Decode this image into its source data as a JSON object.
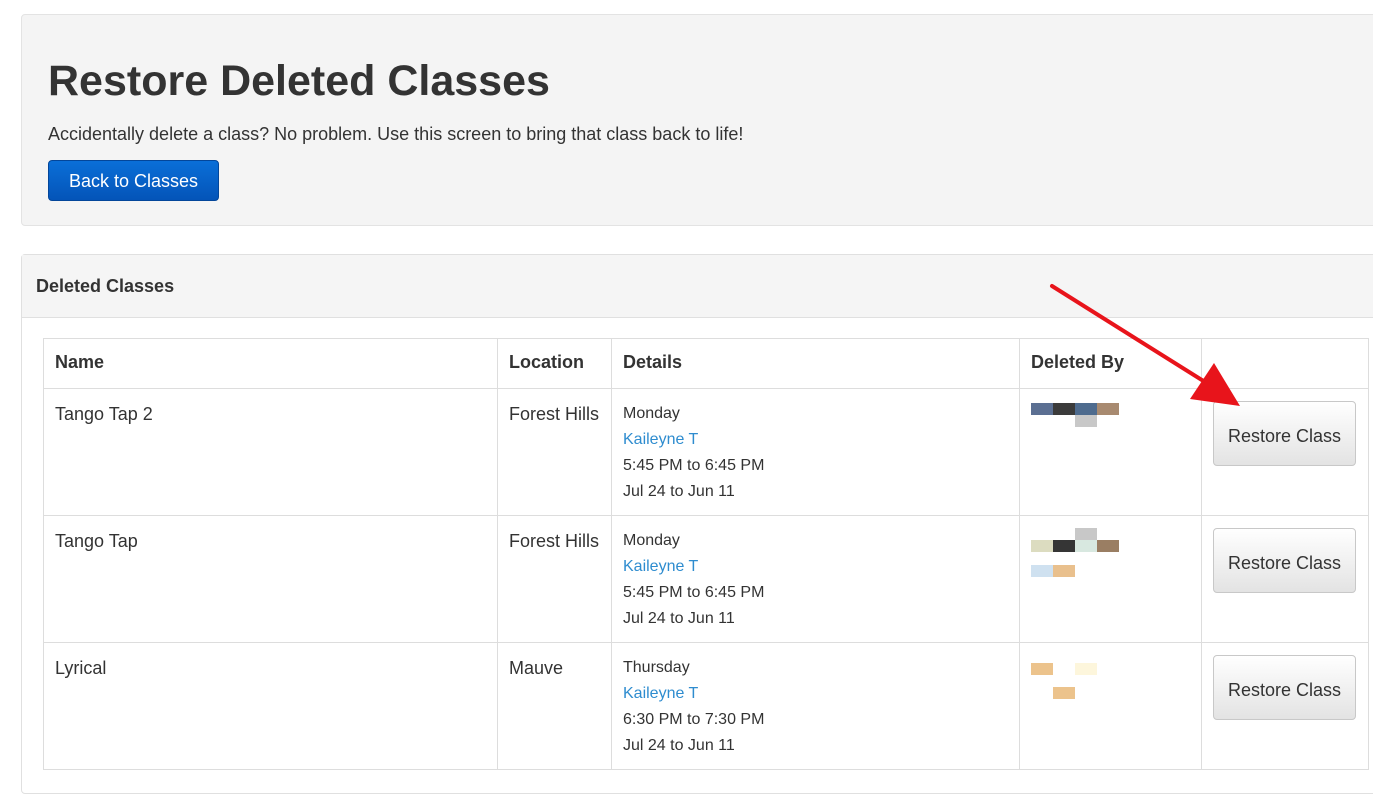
{
  "header": {
    "title": "Restore Deleted Classes",
    "subtitle": "Accidentally delete a class? No problem. Use this screen to bring that class back to life!",
    "back_button": "Back to Classes"
  },
  "panel": {
    "title": "Deleted Classes",
    "columns": [
      "Name",
      "Location",
      "Details",
      "Deleted By",
      ""
    ],
    "rows": [
      {
        "name": "Tango Tap 2",
        "location": "Forest Hills",
        "day": "Monday",
        "instructor": "Kaileyne T",
        "time": "5:45 PM to 6:45 PM",
        "dates": "Jul 24 to Jun 11",
        "action": "Restore Class"
      },
      {
        "name": "Tango Tap",
        "location": "Forest Hills",
        "day": "Monday",
        "instructor": "Kaileyne T",
        "time": "5:45 PM to 6:45 PM",
        "dates": "Jul 24 to Jun 11",
        "action": "Restore Class"
      },
      {
        "name": "Lyrical",
        "location": "Mauve",
        "day": "Thursday",
        "instructor": "Kaileyne T",
        "time": "6:30 PM to 7:30 PM",
        "dates": "Jul 24 to Jun 11",
        "action": "Restore Class"
      }
    ]
  },
  "colors": {
    "primary_button": "#0a63c9",
    "link": "#2e8ccf",
    "annotation_arrow": "#e8141b"
  }
}
